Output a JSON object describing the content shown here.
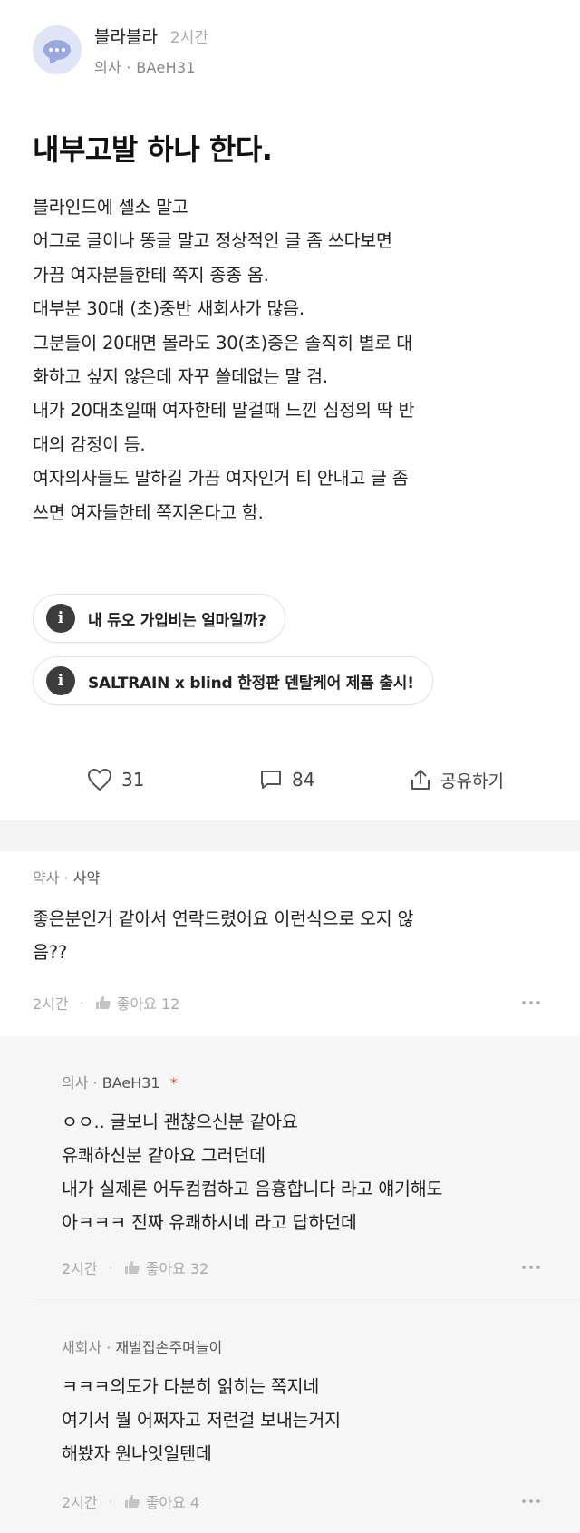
{
  "post": {
    "channel_name": "블라블라",
    "time": "2시간",
    "author_meta": "의사 · BAeH31",
    "title": "내부고발 하나 한다.",
    "body_lines": [
      "블라인드에 셀소 말고",
      "어그로 글이나 똥글 말고 정상적인 글 좀 쓰다보면",
      "가끔 여자분들한테 쪽지 종종 옴.",
      "대부분 30대 (초)중반 새회사가 많음.",
      "그분들이 20대면 몰라도 30(초)중은 솔직히 별로 대",
      "화하고 싶지 않은데 자꾸 쓸데없는 말 검.",
      "내가 20대초일때 여자한테 말걸때 느낀 심정의 딱 반",
      "대의 감정이 듬.",
      "여자의사들도 말하길 가끔 여자인거 티 안내고 글 좀",
      "쓰면 여자들한테 쪽지온다고 함."
    ],
    "promos": [
      {
        "icon": "info-icon",
        "label": "내 듀오 가입비는 얼마일까?"
      },
      {
        "icon": "info-icon",
        "label": "SALTRAIN x blind 한정판 덴탈케어 제품 출시!"
      }
    ],
    "actions": {
      "like_count": "31",
      "comment_count": "84",
      "share_label": "공유하기"
    }
  },
  "comments": [
    {
      "meta_company": "약사",
      "meta_nick": "사약",
      "lines": [
        "좋은분인거 같아서 연락드렸어요  이런식으로 오지 않",
        "음??"
      ],
      "time": "2시간",
      "like_label": "좋아요 12"
    },
    {
      "meta_company": "의사",
      "meta_nick": "BAeH31",
      "op_mark": "*",
      "lines": [
        "ㅇㅇ.. 글보니 괜찮으신분 같아요",
        "유쾌하신분 같아요 그러던데",
        "내가 실제론 어두컴컴하고 음흉합니다 라고 얘기해도",
        "아ㅋㅋㅋ 진짜 유쾌하시네 라고 답하던데"
      ],
      "time": "2시간",
      "like_label": "좋아요 32"
    },
    {
      "meta_company": "새회사",
      "meta_nick": "재벌집손주며늘이",
      "lines": [
        "ㅋㅋㅋ의도가 다분히 읽히는 쪽지네",
        "여기서 뭘 어쩌자고 저런걸 보내는거지",
        "해봤자 원나잇일텐데"
      ],
      "time": "2시간",
      "like_label": "좋아요 4"
    }
  ],
  "colors": {
    "avatar_bg": "#dfe4f7",
    "avatar_icon": "#9aa8e0",
    "op_star": "#e74c3c",
    "reply_bg": "#f6f6f6"
  }
}
